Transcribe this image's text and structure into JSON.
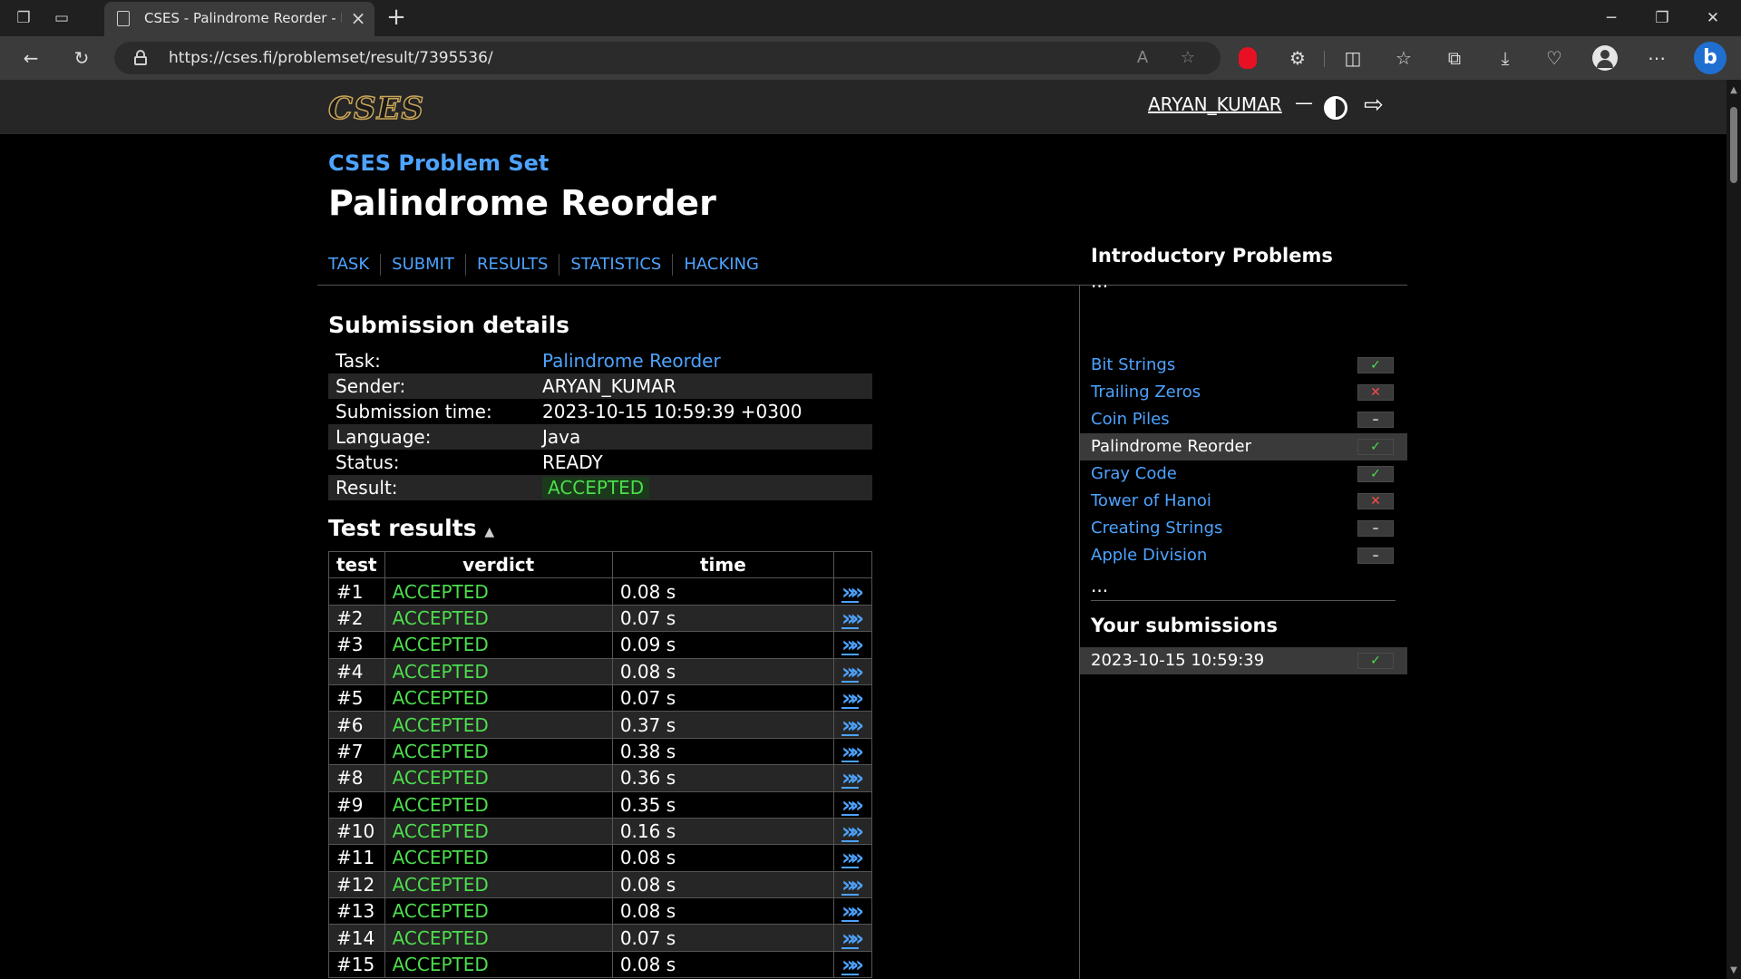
{
  "browser": {
    "tab_title": "CSES - Palindrome Reorder - Res",
    "url": "https://cses.fi/problemset/result/7395536/"
  },
  "site": {
    "logo": "CSES",
    "user": "ARYAN_KUMAR",
    "dash": "—"
  },
  "page": {
    "breadcrumb": "CSES Problem Set",
    "title": "Palindrome Reorder",
    "nav": [
      "TASK",
      "SUBMIT",
      "RESULTS",
      "STATISTICS",
      "HACKING"
    ]
  },
  "submission": {
    "heading": "Submission details",
    "rows": [
      {
        "label": "Task:",
        "value": "Palindrome Reorder"
      },
      {
        "label": "Sender:",
        "value": "ARYAN_KUMAR"
      },
      {
        "label": "Submission time:",
        "value": "2023-10-15 10:59:39 +0300"
      },
      {
        "label": "Language:",
        "value": "Java"
      },
      {
        "label": "Status:",
        "value": "READY"
      },
      {
        "label": "Result:",
        "value": "ACCEPTED"
      }
    ]
  },
  "tests": {
    "heading": "Test results",
    "sort_icon": "▲",
    "columns": [
      "test",
      "verdict",
      "time"
    ],
    "link_glyph": "»",
    "rows": [
      {
        "test": "#1",
        "verdict": "ACCEPTED",
        "time": "0.08 s"
      },
      {
        "test": "#2",
        "verdict": "ACCEPTED",
        "time": "0.07 s"
      },
      {
        "test": "#3",
        "verdict": "ACCEPTED",
        "time": "0.09 s"
      },
      {
        "test": "#4",
        "verdict": "ACCEPTED",
        "time": "0.08 s"
      },
      {
        "test": "#5",
        "verdict": "ACCEPTED",
        "time": "0.07 s"
      },
      {
        "test": "#6",
        "verdict": "ACCEPTED",
        "time": "0.37 s"
      },
      {
        "test": "#7",
        "verdict": "ACCEPTED",
        "time": "0.38 s"
      },
      {
        "test": "#8",
        "verdict": "ACCEPTED",
        "time": "0.36 s"
      },
      {
        "test": "#9",
        "verdict": "ACCEPTED",
        "time": "0.35 s"
      },
      {
        "test": "#10",
        "verdict": "ACCEPTED",
        "time": "0.16 s"
      },
      {
        "test": "#11",
        "verdict": "ACCEPTED",
        "time": "0.08 s"
      },
      {
        "test": "#12",
        "verdict": "ACCEPTED",
        "time": "0.08 s"
      },
      {
        "test": "#13",
        "verdict": "ACCEPTED",
        "time": "0.08 s"
      },
      {
        "test": "#14",
        "verdict": "ACCEPTED",
        "time": "0.07 s"
      },
      {
        "test": "#15",
        "verdict": "ACCEPTED",
        "time": "0.08 s"
      }
    ]
  },
  "sidebar": {
    "heading": "Introductory Problems",
    "ellipsis": "...",
    "problems": [
      {
        "name": "Bit Strings",
        "status": "✓",
        "kind": "ok",
        "current": false
      },
      {
        "name": "Trailing Zeros",
        "status": "✕",
        "kind": "bad",
        "current": false
      },
      {
        "name": "Coin Piles",
        "status": "–",
        "kind": "none",
        "current": false
      },
      {
        "name": "Palindrome Reorder",
        "status": "✓",
        "kind": "ok",
        "current": true
      },
      {
        "name": "Gray Code",
        "status": "✓",
        "kind": "ok",
        "current": false
      },
      {
        "name": "Tower of Hanoi",
        "status": "✕",
        "kind": "bad",
        "current": false
      },
      {
        "name": "Creating Strings",
        "status": "–",
        "kind": "none",
        "current": false
      },
      {
        "name": "Apple Division",
        "status": "–",
        "kind": "none",
        "current": false
      }
    ],
    "submissions_heading": "Your submissions",
    "submissions": [
      {
        "time": "2023-10-15 10:59:39",
        "status": "✓"
      }
    ]
  },
  "colors": {
    "link": "#4da3ff",
    "accepted": "#4cdd4c",
    "failed": "#ff4b4b",
    "header_bg": "#262626"
  },
  "icons": {
    "tab_actions": "tab-actions-icon",
    "vertical_tabs": "vertical-tabs-icon",
    "theme_toggle": "contrast-icon",
    "logout": "logout-icon"
  }
}
